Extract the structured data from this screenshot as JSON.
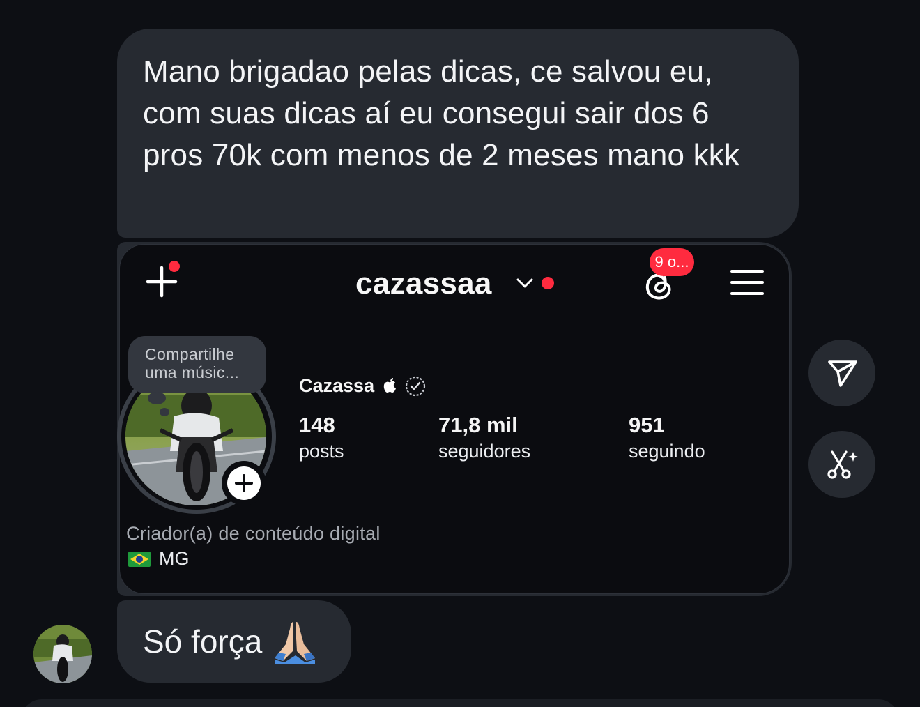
{
  "messages": [
    {
      "text": "Mano brigadao pelas dicas, ce salvou eu, com suas dicas aí eu consegui sair dos 6 pros 70k com menos de 2 meses mano kkk"
    },
    {
      "text": "Só força"
    }
  ],
  "shared_profile": {
    "username": "cazassaa",
    "notification_badge": "9 o...",
    "note": "Compartilhe uma músic...",
    "display_name": "Cazassa",
    "stats": {
      "posts": {
        "value": "148",
        "label": "posts"
      },
      "followers": {
        "value": "71,8 mil",
        "label": "seguidores"
      },
      "following": {
        "value": "951",
        "label": "seguindo"
      }
    },
    "category": "Criador(a) de conteúdo digital",
    "location": "MG"
  },
  "icons": {
    "add": "plus-icon",
    "threads": "threads-icon",
    "menu": "menu-icon",
    "share": "send-icon",
    "cut": "scissors-sparkle-icon",
    "verified": "verified-badge-icon",
    "apple": "apple-icon",
    "flag": "brazil-flag-icon",
    "emoji": "praying-hands-emoji"
  },
  "colors": {
    "background": "#0d0f14",
    "bubble": "#262a31",
    "notification": "#ff2b3f"
  }
}
